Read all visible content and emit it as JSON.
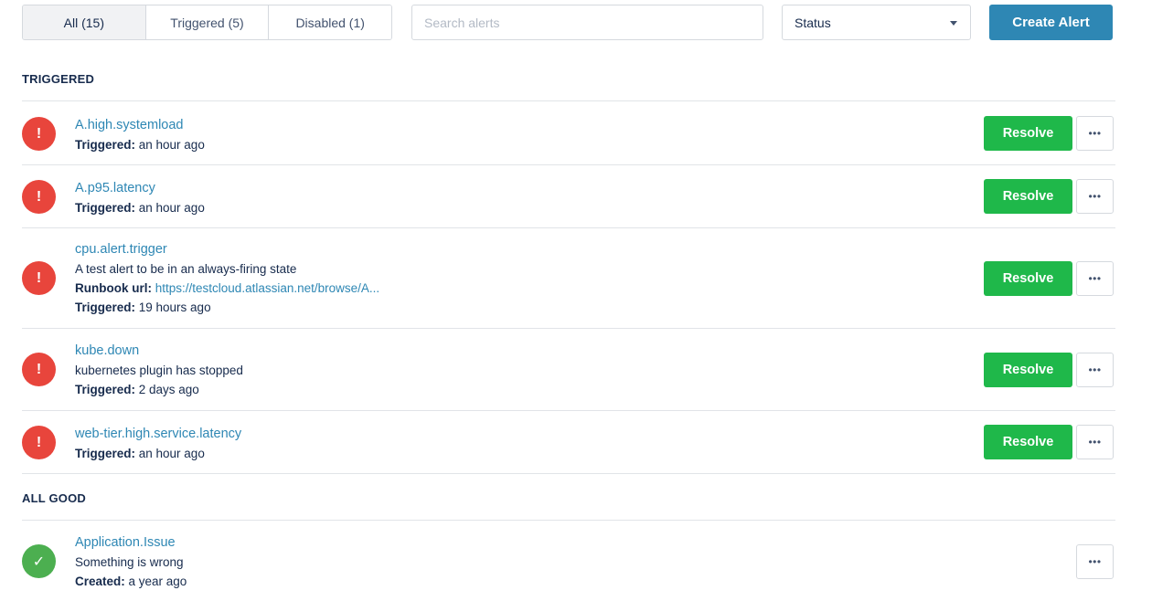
{
  "toolbar": {
    "tabs": [
      {
        "label": "All (15)",
        "active": true
      },
      {
        "label": "Triggered (5)",
        "active": false
      },
      {
        "label": "Disabled (1)",
        "active": false
      }
    ],
    "search_placeholder": "Search alerts",
    "status_label": "Status",
    "create_label": "Create Alert"
  },
  "sections": {
    "triggered_title": "TRIGGERED",
    "all_good_title": "ALL GOOD"
  },
  "icons": {
    "triggered_glyph": "!",
    "good_glyph": "✓",
    "more_glyph": "•••"
  },
  "colors": {
    "accent": "#2e87b4",
    "triggered": "#e8453c",
    "good": "#4caf50",
    "resolve": "#1fb84a"
  },
  "triggered_alerts": [
    {
      "name": "A.high.systemload",
      "triggered_label": "Triggered:",
      "triggered_value": " an hour ago",
      "resolve_label": "Resolve"
    },
    {
      "name": "A.p95.latency",
      "triggered_label": "Triggered:",
      "triggered_value": " an hour ago",
      "resolve_label": "Resolve"
    },
    {
      "name": "cpu.alert.trigger",
      "description": "A test alert to be in an always-firing state",
      "runbook_label": "Runbook url:",
      "runbook_url": "https://testcloud.atlassian.net/browse/A...",
      "triggered_label": "Triggered:",
      "triggered_value": " 19 hours ago",
      "resolve_label": "Resolve"
    },
    {
      "name": "kube.down",
      "description": "kubernetes plugin has stopped",
      "triggered_label": "Triggered:",
      "triggered_value": " 2 days ago",
      "resolve_label": "Resolve"
    },
    {
      "name": "web-tier.high.service.latency",
      "triggered_label": "Triggered:",
      "triggered_value": " an hour ago",
      "resolve_label": "Resolve"
    }
  ],
  "good_alerts": [
    {
      "name": "Application.Issue",
      "description": "Something is wrong",
      "created_label": "Created:",
      "created_value": " a year ago"
    }
  ]
}
